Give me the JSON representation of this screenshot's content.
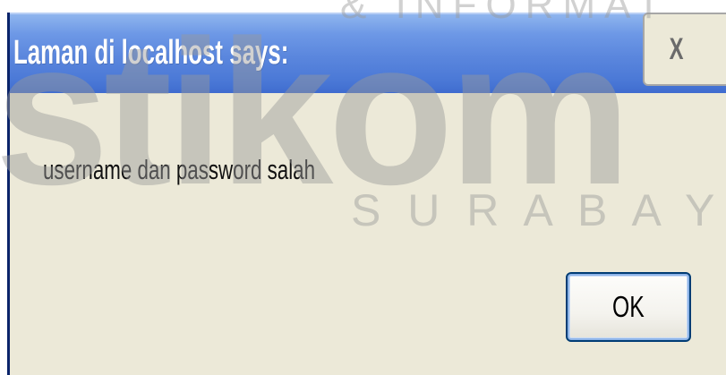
{
  "dialog": {
    "title": "Laman di localhost says:",
    "close_label": "X",
    "message": "username dan password salah",
    "ok_label": "OK"
  },
  "watermark": {
    "logo": "stikom",
    "top_text": "& INFORMAT",
    "bottom_text": "S U R A B A Y A"
  },
  "colors": {
    "titlebar": "#5a86dd",
    "dialog_body": "#ece9d8",
    "frame": "#0a246a",
    "watermark": "#c0c0c0"
  }
}
